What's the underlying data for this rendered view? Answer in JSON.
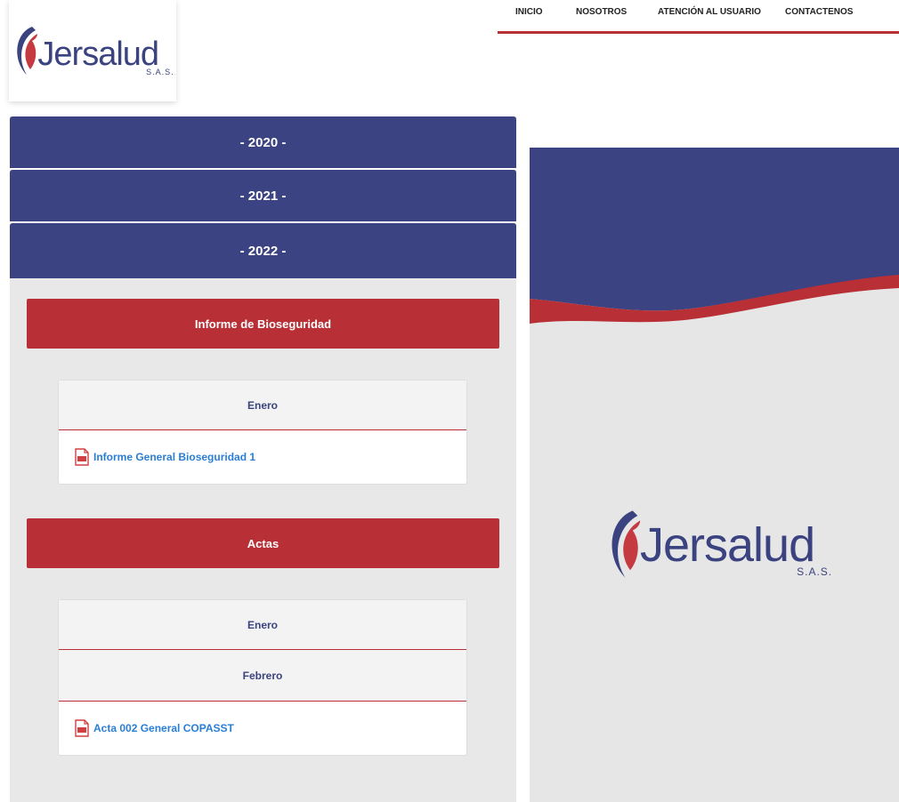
{
  "brand": {
    "name": "Jersalud",
    "suffix": "S.A.S."
  },
  "nav": {
    "items": [
      "INICIO",
      "NOSOTROS",
      "ATENCIÓN AL USUARIO",
      "CONTACTENOS"
    ]
  },
  "years": [
    "- 2020 -",
    "- 2021 -",
    "- 2022 -"
  ],
  "sections": {
    "bioseguridad": {
      "title": "Informe de Bioseguridad",
      "month": "Enero",
      "file": "Informe General Bioseguridad 1"
    },
    "actas": {
      "title": "Actas",
      "month1": "Enero",
      "month2": "Febrero",
      "file": "Acta 002 General COPASST"
    }
  },
  "colors": {
    "navy": "#3b4382",
    "red": "#b82f36",
    "link": "#2a7ed6"
  },
  "icons": {
    "file": "pdf-icon",
    "logo": "jersalud-swirl-icon"
  }
}
